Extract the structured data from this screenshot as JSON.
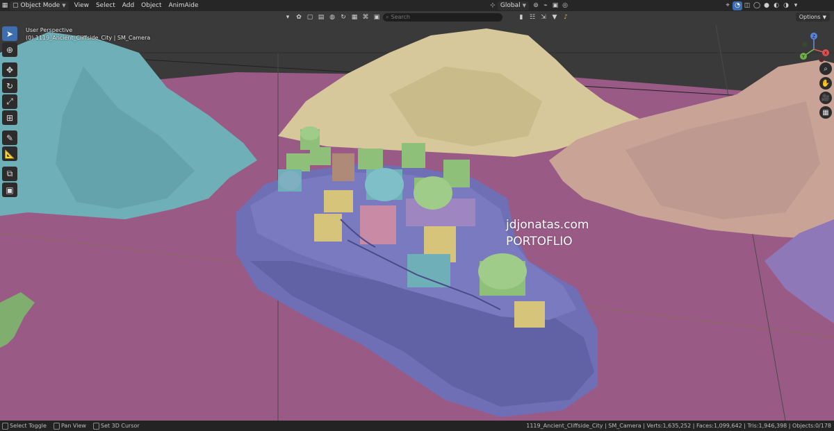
{
  "topbar": {
    "mode_label": "Object Mode",
    "menus": [
      "View",
      "Select",
      "Add",
      "Object",
      "AnimAide"
    ],
    "orientation_label": "Global"
  },
  "header2": {
    "search_placeholder": "Search"
  },
  "viewport": {
    "perspective": "User Perspective",
    "collection_line": "(0) 1119_Ancient_Cliffside_City | SM_Camera",
    "options_label": "Options"
  },
  "watermark": {
    "line1": "jdjonatas.com",
    "line2": "PORTOFLIO"
  },
  "statusbar": {
    "hints": [
      {
        "label": "Select Toggle"
      },
      {
        "label": "Pan View"
      },
      {
        "label": "Set 3D Cursor"
      }
    ],
    "stats": "1119_Ancient_Cliffside_City | SM_Camera | Verts:1,635,252 | Faces:1,099,642 | Tris:1,946,398 | Objects:0/178"
  },
  "gizmo": {
    "x": "X",
    "y": "Y",
    "z": "Z"
  },
  "colors": {
    "accent": "#3d6fb0",
    "ground": "#9a5a86",
    "island": "#6f6fb6",
    "teal_mountain": "#6fb0b8",
    "sand_mountain": "#d6c89a",
    "peach_mountain": "#c9a396"
  }
}
